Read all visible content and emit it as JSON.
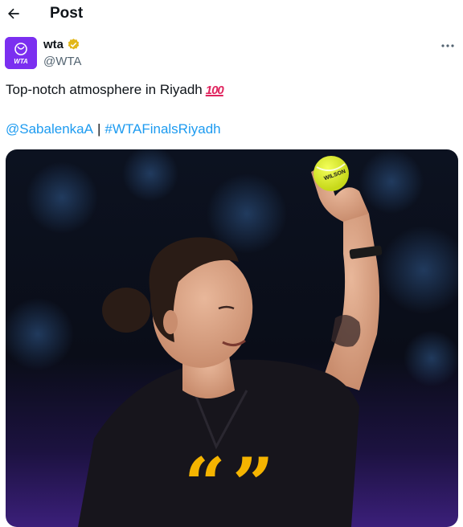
{
  "header": {
    "title": "Post",
    "back_icon": "arrow-left-icon"
  },
  "author": {
    "display_name": "wta",
    "handle": "@WTA",
    "avatar_text": "WTA",
    "verified_icon": "gold-verified-badge-icon",
    "avatar_color": "#7b2ff0"
  },
  "more_icon": "more-horizontal-icon",
  "tweet": {
    "text": "Top-notch atmosphere in Riyadh",
    "emoji": "100",
    "mention": "@SabalenkaA",
    "separator": "|",
    "hashtag": "#WTAFinalsRiyadh"
  },
  "media": {
    "description_icon": "quote-marks-icon",
    "quote_color": "#f5b400",
    "ball_text": "WILSON"
  },
  "colors": {
    "link": "#1d9bf0",
    "text": "#0f1419",
    "muted": "#536471"
  }
}
